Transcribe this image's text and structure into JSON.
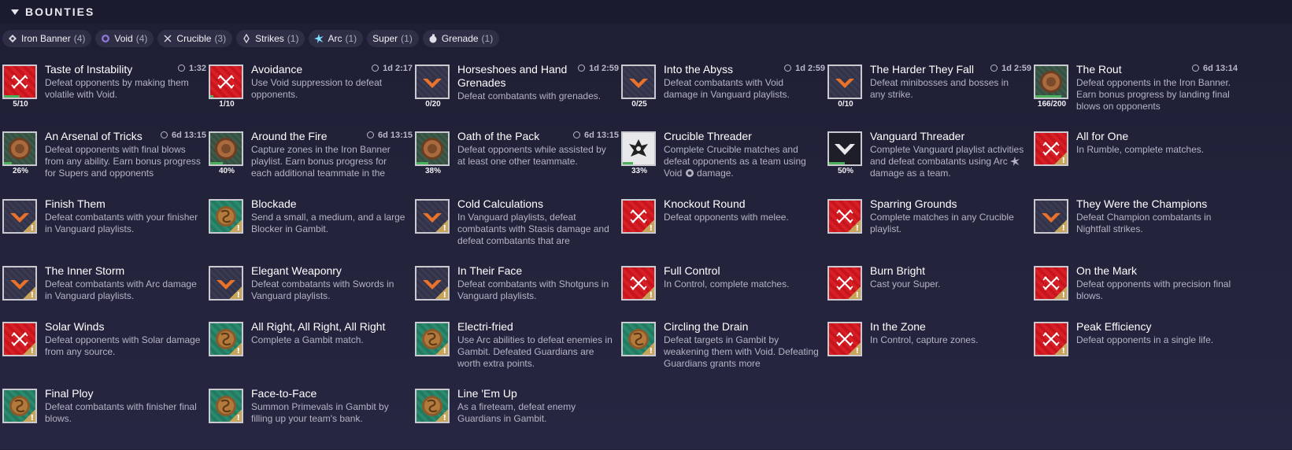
{
  "header": {
    "title": "BOUNTIES"
  },
  "filters": [
    {
      "label": "Iron Banner",
      "count": "(4)",
      "icon": "iron-banner-icon"
    },
    {
      "label": "Void",
      "count": "(4)",
      "icon": "void-icon",
      "color": "#a58ae0"
    },
    {
      "label": "Crucible",
      "count": "(3)",
      "icon": "crucible-icon"
    },
    {
      "label": "Strikes",
      "count": "(1)",
      "icon": "strikes-icon"
    },
    {
      "label": "Arc",
      "count": "(1)",
      "icon": "arc-icon",
      "color": "#7fe0ff"
    },
    {
      "label": "Super",
      "count": "(1)",
      "icon": ""
    },
    {
      "label": "Grenade",
      "count": "(1)",
      "icon": "grenade-icon"
    }
  ],
  "bounties": [
    {
      "title": "Taste of Instability",
      "timer": "1:32",
      "desc": "Defeat opponents by making them volatile with Void.",
      "icon": "crucible-icon",
      "style": "red",
      "progress": "5/10",
      "pct": 0.5
    },
    {
      "title": "Avoidance",
      "timer": "1d 2:17",
      "desc": "Use Void suppression to defeat opponents.",
      "icon": "crucible-icon",
      "style": "red",
      "progress": "1/10",
      "pct": 0.1
    },
    {
      "title": "Horseshoes and Hand Grenades",
      "timer": "1d 2:59",
      "desc": "Defeat combatants with grenades.",
      "icon": "vanguard-icon",
      "style": "dark",
      "progress": "0/20",
      "pct": 0
    },
    {
      "title": "Into the Abyss",
      "timer": "1d 2:59",
      "desc": "Defeat combatants with Void damage in Vanguard playlists.",
      "icon": "vanguard-icon",
      "style": "dark",
      "progress": "0/25",
      "pct": 0
    },
    {
      "title": "The Harder They Fall",
      "timer": "1d 2:59",
      "desc": "Defeat minibosses and bosses in any strike.",
      "icon": "vanguard-icon",
      "style": "dark",
      "progress": "0/10",
      "pct": 0
    },
    {
      "title": "The Rout",
      "timer": "6d 13:14",
      "desc": "Defeat opponents in the Iron Banner. Earn bonus progress by landing final blows on opponents",
      "icon": "iron-banner-icon",
      "style": "iron",
      "progress": "166/200",
      "pct": 0.83
    },
    {
      "title": "An Arsenal of Tricks",
      "timer": "6d 13:15",
      "desc": "Defeat opponents with final blows from any ability. Earn bonus progress for Supers and opponents",
      "icon": "iron-banner-icon",
      "style": "iron",
      "progress": "26%",
      "pct": 0.26
    },
    {
      "title": "Around the Fire",
      "timer": "6d 13:15",
      "desc": "Capture zones in the Iron Banner playlist. Earn bonus progress for each additional teammate in the",
      "icon": "iron-banner-icon",
      "style": "iron",
      "progress": "40%",
      "pct": 0.4
    },
    {
      "title": "Oath of the Pack",
      "timer": "6d 13:15",
      "desc": "Defeat opponents while assisted by at least one other teammate.",
      "icon": "iron-banner-icon",
      "style": "iron",
      "progress": "38%",
      "pct": 0.38
    },
    {
      "title": "Crucible Threader",
      "timer": "",
      "desc_a": "Complete Crucible matches and defeat opponents as a team using Void",
      "desc_b": "damage.",
      "inline_icon": "void-icon",
      "icon": "crucible-threader-icon",
      "style": "white",
      "progress": "33%",
      "pct": 0.33
    },
    {
      "title": "Vanguard Threader",
      "timer": "",
      "desc_a": "Complete Vanguard playlist activities and defeat combatants using Arc",
      "desc_b": "damage as a team.",
      "inline_icon": "arc-icon",
      "icon": "vanguard-threader-icon",
      "style": "white",
      "progress": "50%",
      "pct": 0.5
    },
    {
      "title": "All for One",
      "timer": "",
      "desc": "In Rumble, complete matches.",
      "icon": "crucible-icon",
      "style": "red",
      "warn": true
    },
    {
      "title": "Finish Them",
      "timer": "",
      "desc": "Defeat combatants with your finisher in Vanguard playlists.",
      "icon": "vanguard-icon",
      "style": "dark",
      "warn": true
    },
    {
      "title": "Blockade",
      "timer": "",
      "desc": "Send a small, a medium, and a large Blocker in Gambit.",
      "icon": "gambit-icon",
      "style": "green",
      "warn": true
    },
    {
      "title": "Cold Calculations",
      "timer": "",
      "desc": "In Vanguard playlists, defeat combatants with Stasis damage and defeat combatants that are",
      "icon": "vanguard-icon",
      "style": "dark",
      "warn": true
    },
    {
      "title": "Knockout Round",
      "timer": "",
      "desc": "Defeat opponents with melee.",
      "icon": "crucible-icon",
      "style": "red",
      "warn": true
    },
    {
      "title": "Sparring Grounds",
      "timer": "",
      "desc": "Complete matches in any Crucible playlist.",
      "icon": "crucible-icon",
      "style": "red",
      "warn": true
    },
    {
      "title": "They Were the Champions",
      "timer": "",
      "desc": "Defeat Champion combatants in Nightfall strikes.",
      "icon": "vanguard-icon",
      "style": "dark",
      "warn": true
    },
    {
      "title": "The Inner Storm",
      "timer": "",
      "desc": "Defeat combatants with Arc damage in Vanguard playlists.",
      "icon": "vanguard-icon",
      "style": "dark",
      "warn": true
    },
    {
      "title": "Elegant Weaponry",
      "timer": "",
      "desc": "Defeat combatants with Swords in Vanguard playlists.",
      "icon": "vanguard-icon",
      "style": "dark",
      "warn": true
    },
    {
      "title": "In Their Face",
      "timer": "",
      "desc": "Defeat combatants with Shotguns in Vanguard playlists.",
      "icon": "vanguard-icon",
      "style": "dark",
      "warn": true
    },
    {
      "title": "Full Control",
      "timer": "",
      "desc": "In Control, complete matches.",
      "icon": "crucible-icon",
      "style": "red",
      "warn": true
    },
    {
      "title": "Burn Bright",
      "timer": "",
      "desc": "Cast your Super.",
      "icon": "crucible-icon",
      "style": "red",
      "warn": true
    },
    {
      "title": "On the Mark",
      "timer": "",
      "desc": "Defeat opponents with precision final blows.",
      "icon": "crucible-icon",
      "style": "red",
      "warn": true
    },
    {
      "title": "Solar Winds",
      "timer": "",
      "desc": "Defeat opponents with Solar damage from any source.",
      "icon": "crucible-icon",
      "style": "red",
      "warn": true
    },
    {
      "title": "All Right, All Right, All Right",
      "timer": "",
      "desc": "Complete a Gambit match.",
      "icon": "gambit-icon",
      "style": "green",
      "warn": true
    },
    {
      "title": "Electri-fried",
      "timer": "",
      "desc": "Use Arc abilities to defeat enemies in Gambit. Defeated Guardians are worth extra points.",
      "icon": "gambit-icon",
      "style": "green",
      "warn": true
    },
    {
      "title": "Circling the Drain",
      "timer": "",
      "desc": "Defeat targets in Gambit by weakening them with Void. Defeating Guardians grants more",
      "icon": "gambit-icon",
      "style": "green",
      "warn": true
    },
    {
      "title": "In the Zone",
      "timer": "",
      "desc": "In Control, capture zones.",
      "icon": "crucible-icon",
      "style": "red",
      "warn": true
    },
    {
      "title": "Peak Efficiency",
      "timer": "",
      "desc": "Defeat opponents in a single life.",
      "icon": "crucible-icon",
      "style": "red",
      "warn": true
    },
    {
      "title": "Final Ploy",
      "timer": "",
      "desc": "Defeat combatants with finisher final blows.",
      "icon": "gambit-icon",
      "style": "green",
      "warn": true
    },
    {
      "title": "Face-to-Face",
      "timer": "",
      "desc": "Summon Primevals in Gambit by filling up your team's bank.",
      "icon": "gambit-icon",
      "style": "green",
      "warn": true
    },
    {
      "title": "Line 'Em Up",
      "timer": "",
      "desc": "As a fireteam, defeat enemy Guardians in Gambit.",
      "icon": "gambit-icon",
      "style": "green",
      "warn": true
    }
  ]
}
